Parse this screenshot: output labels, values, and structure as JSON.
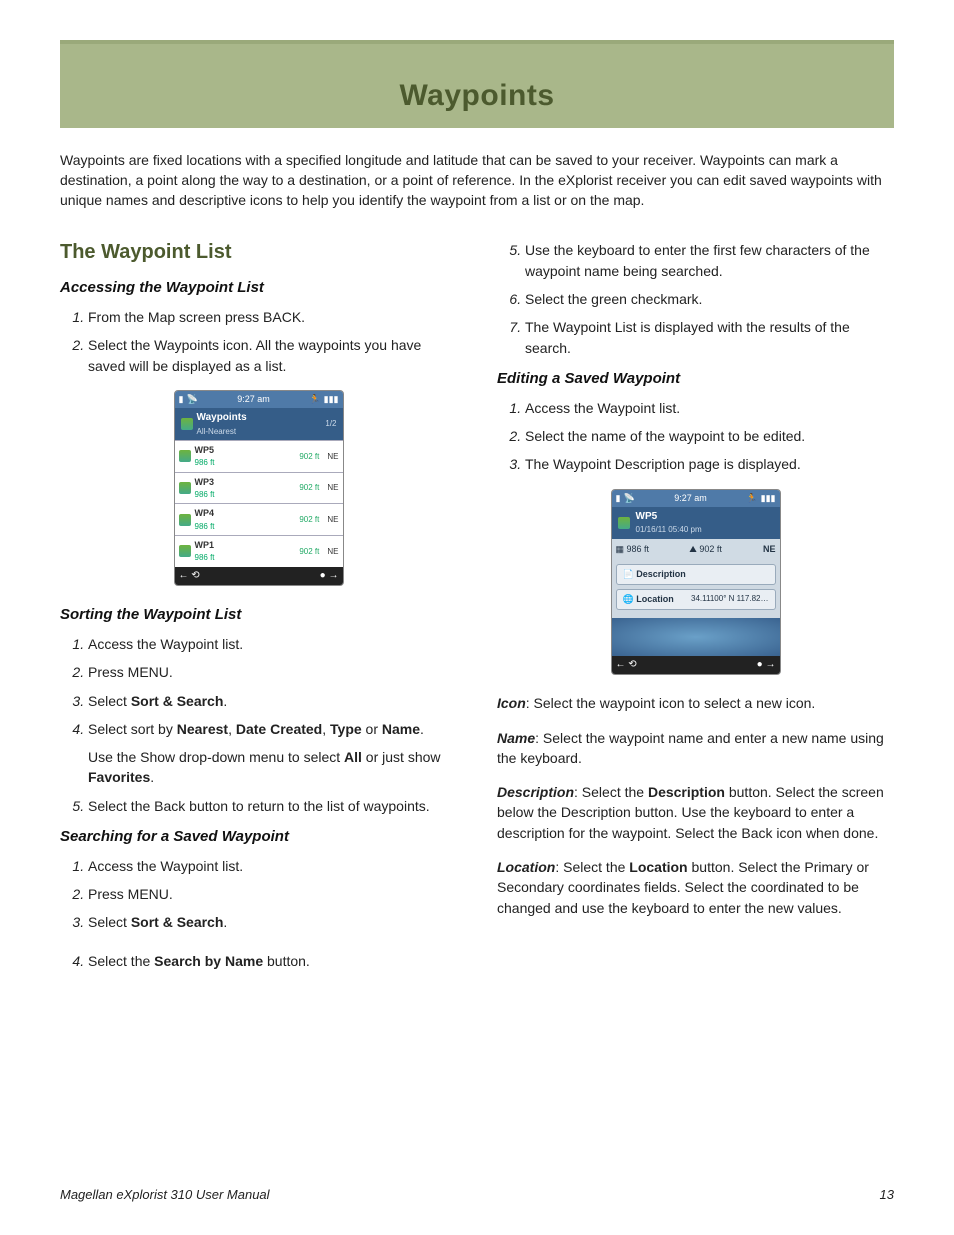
{
  "title": "Waypoints",
  "intro": "Waypoints are fixed locations with a specified longitude and latitude that can be saved to your receiver.  Waypoints can mark a destination, a point along the way to a destination, or a point of reference.  In the eXplorist receiver you can edit saved waypoints with unique names and descriptive icons to help you identify the waypoint from a list or on the map.",
  "section_heading": "The Waypoint List",
  "accessing": {
    "heading": "Accessing the Waypoint List",
    "s1": "From the Map screen press BACK.",
    "s2": "Select the Waypoints icon.  All the waypoints you have saved will be displayed as a list."
  },
  "sorting": {
    "heading": "Sorting the Waypoint List",
    "s1": "Access the Waypoint list.",
    "s2": "Press MENU.",
    "s3a": "Select ",
    "s3b": "Sort & Search",
    "s3c": ".",
    "s4a": "Select sort by ",
    "s4b": "Nearest",
    "s4c": ", ",
    "s4d": "Date Created",
    "s4e": ", ",
    "s4f": "Type",
    "s4g": " or ",
    "s4h": "Name",
    "s4i": ".",
    "s4_extra_a": "Use the Show drop-down menu to select ",
    "s4_extra_b": "All",
    "s4_extra_c": " or just show ",
    "s4_extra_d": "Favorites",
    "s4_extra_e": ".",
    "s5": "Select the Back button to return to the list of waypoints."
  },
  "searching": {
    "heading": "Searching for a Saved Waypoint",
    "s1": "Access the Waypoint list.",
    "s2": "Press MENU.",
    "s3a": "Select ",
    "s3b": "Sort & Search",
    "s3c": ".",
    "s4a": "Select the ",
    "s4b": "Search by Name",
    "s4c": " button.",
    "s5": "Use the keyboard to enter the first few characters of the waypoint name being searched.",
    "s6": "Select the green checkmark.",
    "s7": "The Waypoint List is displayed with the results of the search."
  },
  "editing": {
    "heading": "Editing a Saved Waypoint",
    "s1": "Access the Waypoint list.",
    "s2": "Select the name of the waypoint to be edited.",
    "s3": "The Waypoint Description page is displayed."
  },
  "defs": {
    "icon_label": "Icon",
    "icon_text": ":  Select the waypoint icon to select a new icon.",
    "name_label": "Name",
    "name_text": ":  Select the waypoint name and enter a new name using the keyboard.",
    "desc_label": "Description",
    "desc_text_a": ":  Select the ",
    "desc_text_b": "Description",
    "desc_text_c": " button.  Select the screen below the Description button.  Use the keyboard to enter a description for the waypoint.  Select the Back icon when done.",
    "loc_label": "Location",
    "loc_text_a": ":  Select the ",
    "loc_text_b": "Location",
    "loc_text_c": " button.  Select the Primary or Secondary coordinates fields.  Select the coordinated to be changed and use the keyboard to enter the new values."
  },
  "shot_list": {
    "time": "9:27 am",
    "title": "Waypoints",
    "sub": "All-Nearest",
    "page": "1/2",
    "rows": [
      {
        "name": "WP5",
        "d": "986 ft",
        "r": "902 ft",
        "c": "NE"
      },
      {
        "name": "WP3",
        "d": "986 ft",
        "r": "902 ft",
        "c": "NE"
      },
      {
        "name": "WP4",
        "d": "986 ft",
        "r": "902 ft",
        "c": "NE"
      },
      {
        "name": "WP1",
        "d": "986 ft",
        "r": "902 ft",
        "c": "NE"
      }
    ]
  },
  "shot_desc": {
    "time": "9:27 am",
    "name": "WP5",
    "date": "01/16/11  05:40 pm",
    "d1": "986 ft",
    "d2": "902 ft",
    "d3": "NE",
    "btn_desc": "Description",
    "btn_loc": "Location",
    "loc_val": "34.11100° N 117.82…"
  },
  "footer": {
    "manual": "Magellan eXplorist 310 User Manual",
    "page": "13"
  }
}
